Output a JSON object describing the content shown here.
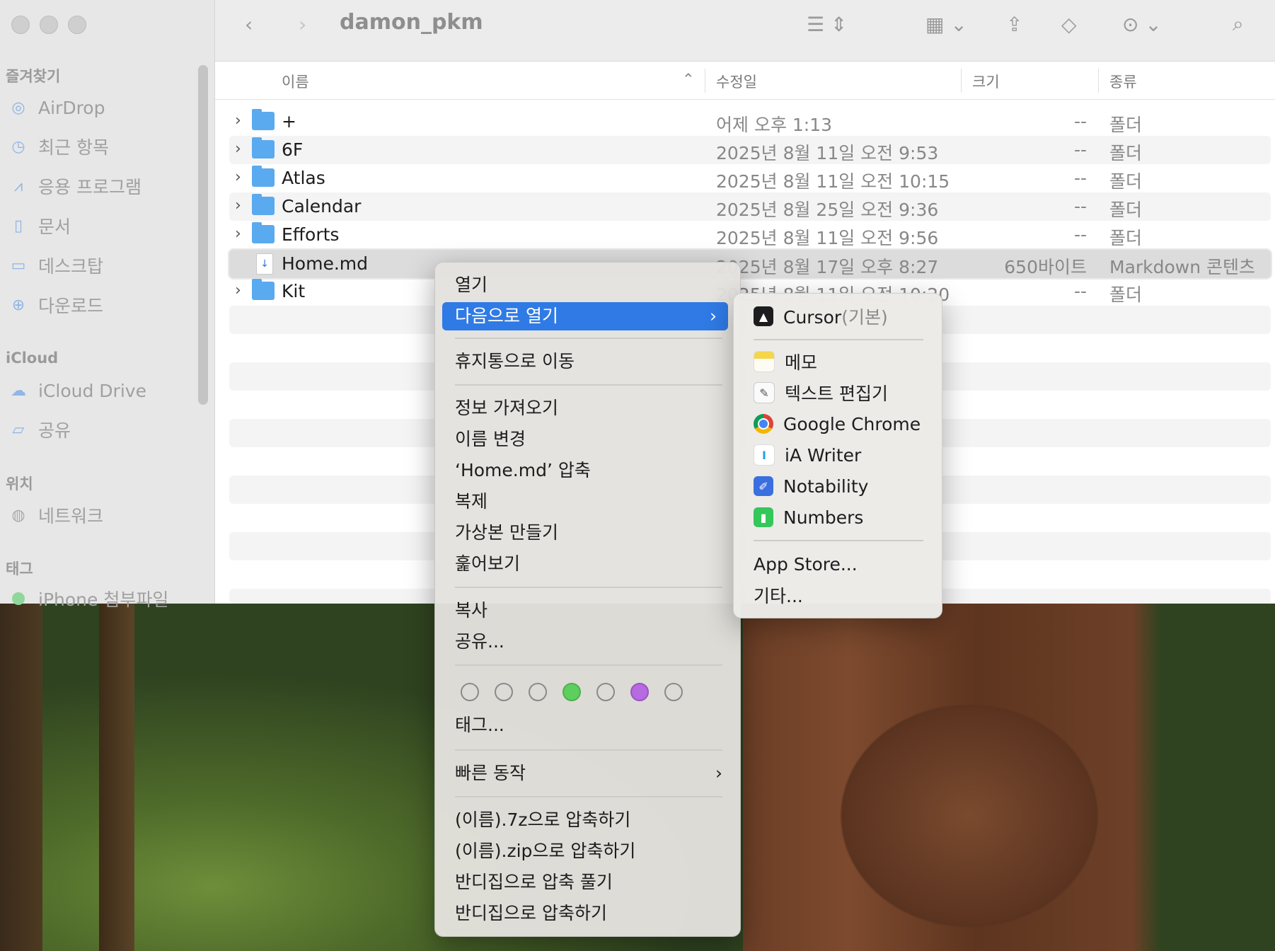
{
  "window": {
    "title": "damon_pkm"
  },
  "sidebar": {
    "favorites_heading": "즐겨찾기",
    "favorites": [
      {
        "label": "AirDrop",
        "icon": "airdrop-icon"
      },
      {
        "label": "최근 항목",
        "icon": "clock-icon"
      },
      {
        "label": "응용 프로그램",
        "icon": "applications-icon"
      },
      {
        "label": "문서",
        "icon": "document-icon"
      },
      {
        "label": "데스크탑",
        "icon": "desktop-icon"
      },
      {
        "label": "다운로드",
        "icon": "download-icon"
      }
    ],
    "icloud_heading": "iCloud",
    "icloud": [
      {
        "label": "iCloud Drive",
        "icon": "cloud-icon"
      },
      {
        "label": "공유",
        "icon": "shared-folder-icon"
      }
    ],
    "locations_heading": "위치",
    "locations": [
      {
        "label": "네트워크",
        "icon": "network-icon"
      }
    ],
    "tags_heading": "태그",
    "tags": [
      {
        "label": "iPhone 첨부파일",
        "color": "#4cd964"
      }
    ]
  },
  "columns": {
    "name": "이름",
    "modified": "수정일",
    "size": "크기",
    "kind": "종류"
  },
  "files": [
    {
      "name": "+",
      "date": "어제 오후 1:13",
      "size": "--",
      "kind": "폴더",
      "type": "folder"
    },
    {
      "name": "6F",
      "date": "2025년 8월 11일 오전 9:53",
      "size": "--",
      "kind": "폴더",
      "type": "folder"
    },
    {
      "name": "Atlas",
      "date": "2025년 8월 11일 오전 10:15",
      "size": "--",
      "kind": "폴더",
      "type": "folder"
    },
    {
      "name": "Calendar",
      "date": "2025년 8월 25일 오전 9:36",
      "size": "--",
      "kind": "폴더",
      "type": "folder"
    },
    {
      "name": "Efforts",
      "date": "2025년 8월 11일 오전 9:56",
      "size": "--",
      "kind": "폴더",
      "type": "folder"
    },
    {
      "name": "Home.md",
      "date": "2025년 8월 17일 오후 8:27",
      "size": "650바이트",
      "kind": "Markdown 콘텐츠",
      "type": "file"
    },
    {
      "name": "Kit",
      "date": "2025년 8월 11일 오전 10:20",
      "size": "--",
      "kind": "폴더",
      "type": "folder"
    }
  ],
  "context_menu": {
    "open": "열기",
    "open_with": "다음으로 열기",
    "move_to_trash": "휴지통으로 이동",
    "get_info": "정보 가져오기",
    "rename": "이름 변경",
    "compress": "‘Home.md’ 압축",
    "duplicate": "복제",
    "make_alias": "가상본 만들기",
    "quick_look": "훑어보기",
    "copy": "복사",
    "share": "공유...",
    "tag_colors": [
      "none",
      "none",
      "none",
      "#5ccf5c",
      "none",
      "#b86ae0",
      "none"
    ],
    "tags": "태그...",
    "quick_actions": "빠른 동작",
    "compress_7z": "(이름).7z으로 압축하기",
    "compress_zip": "(이름).zip으로 압축하기",
    "bandizip_extract": "반디집으로 압축 풀기",
    "bandizip_compress": "반디집으로 압축하기"
  },
  "open_with_menu": {
    "default_app": "Cursor",
    "default_suffix": "(기본)",
    "apps": [
      "메모",
      "텍스트 편집기",
      "Google Chrome",
      "iA Writer",
      "Notability",
      "Numbers"
    ],
    "app_store": "App Store...",
    "other": "기타..."
  },
  "colors": {
    "selection": "#2f7ae5",
    "folder": "#5aaaf0"
  }
}
